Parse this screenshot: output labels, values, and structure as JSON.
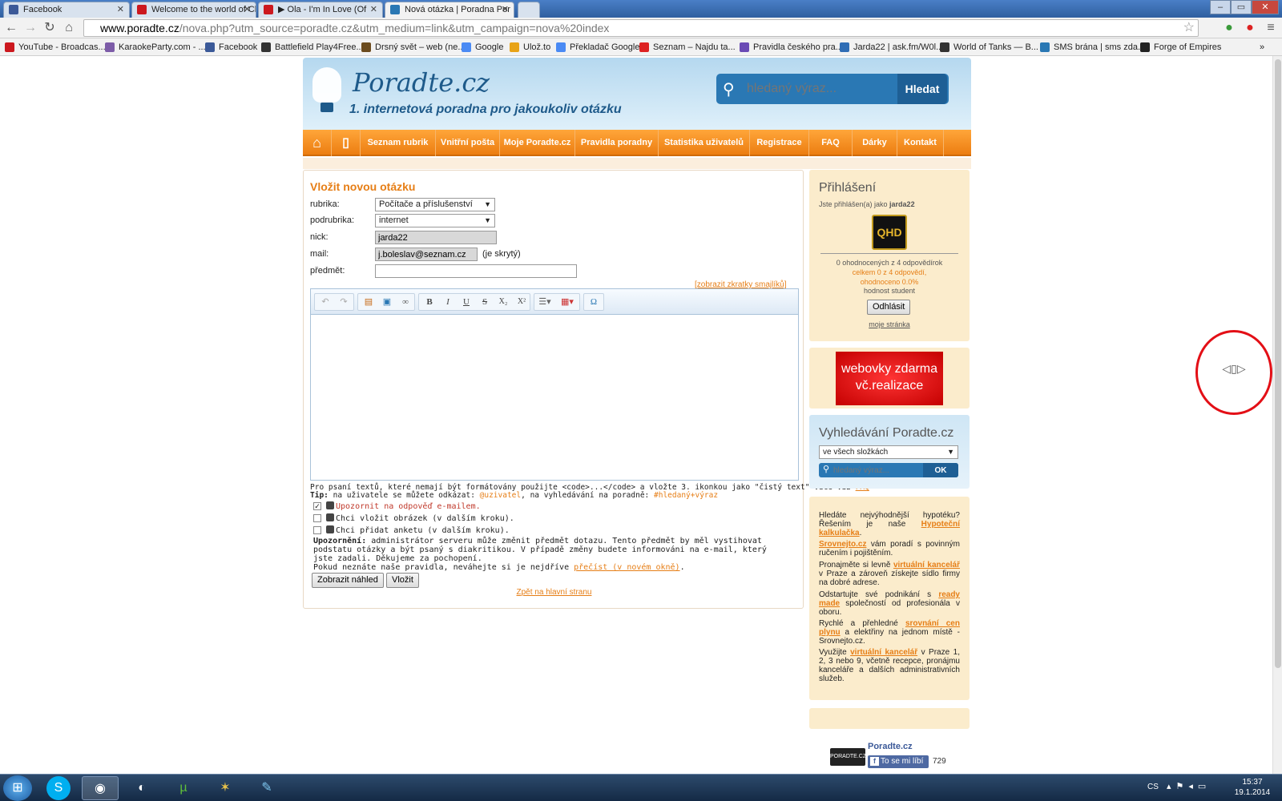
{
  "browser": {
    "tabs": [
      {
        "label": "Facebook",
        "color": "#3b5998"
      },
      {
        "label": "Welcome to the world of Ch",
        "color": "#cc181e"
      },
      {
        "label": "▶ Ola - I'm In Love (Of",
        "color": "#cc181e"
      },
      {
        "label": "Nová otázka | Poradna Por",
        "color": "#2a78b4"
      }
    ],
    "url_host": "www.poradte.cz",
    "url_rest": "/nova.php?utm_source=poradte.cz&utm_medium=link&utm_campaign=nova%20index",
    "bookmarks": [
      "YouTube - Broadcas...",
      "KaraokeParty.com - ...",
      "Facebook",
      "Battlefield Play4Free...",
      "Drsný svět – web (ne...",
      "Google",
      "Ulož.to",
      "Překladač Google",
      "Seznam – Najdu ta...",
      "Pravidla českého pra...",
      "Jarda22 | ask.fm/W0l...",
      "World of Tanks — B...",
      "SMS brána | sms zda...",
      "Forge of Empires"
    ],
    "bookmarks_more": "»"
  },
  "header": {
    "logo": "Poradte.cz",
    "tagline": "1. internetová poradna pro jakoukoliv otázku",
    "search_placeholder": "hledaný výraz...",
    "search_button": "Hledat"
  },
  "menu": {
    "items": [
      "Seznam rubrik",
      "Vnitřní pošta",
      "Moje Poradte.cz",
      "Pravidla poradny",
      "Statistika uživatelů",
      "Registrace",
      "FAQ",
      "Dárky",
      "Kontakt"
    ]
  },
  "form": {
    "title": "Vložit novou otázku",
    "rubrika_label": "rubrika:",
    "rubrika_value": "Počítače a příslušenství",
    "podrubrika_label": "podrubrika:",
    "podrubrika_value": "internet",
    "nick_label": "nick:",
    "nick_value": "jarda22",
    "mail_label": "mail:",
    "mail_value": "j.boleslav@seznam.cz",
    "mail_hidden_note": "(je skrytý)",
    "predmet_label": "předmět:",
    "predmet_value": "",
    "smileys_link": "[zobrazit zkratky smajlíků]",
    "help_text_1a": "Pro psaní textů, které nemají být formátovány použijte <code>...</code> a vložte 3. ikonkou jako \"čistý text\" více viz ",
    "help_text_1_link": "FAQ",
    "help_tip_bold": "Tip:",
    "help_text_2a": " na uživatele se můžete odkázat: ",
    "help_text_2_user": "@uzivatel",
    "help_text_2b": ", na vyhledávání na poradně: ",
    "help_text_2_tag": "#hledaný+výraz",
    "check_email": "Upozornit na odpověď e-mailem.",
    "check_image": "Chci vložit obrázek (v dalším kroku).",
    "check_poll": "Chci přidat anketu (v dalším kroku).",
    "notice_bold": "Upozornění:",
    "notice_text": " administrátor serveru může změnit předmět dotazu. Tento předmět by měl vystihovat podstatu otázky a být psaný s diakritikou. V případě změny budete informováni na e-mail, který jste zadali. Děkujeme za pochopení.",
    "notice_text_2": "Pokud neznáte naše pravidla, neváhejte si je nejdříve ",
    "notice_link": "přečíst (v novém okně)",
    "preview_button": "Zobrazit náhled",
    "submit_button": "Vložit",
    "back_link": "Zpět na hlavní stranu"
  },
  "editor": {
    "buttons": [
      "undo-icon",
      "redo-icon",
      "paste-text-icon",
      "image-icon",
      "link-icon",
      "bold-icon",
      "italic-icon",
      "underline-icon",
      "strike-icon",
      "subscript-icon",
      "superscript-icon",
      "list-icon",
      "table-icon",
      "omega-icon"
    ],
    "bold": "B",
    "italic": "I",
    "underline": "U",
    "strike": "S",
    "sub": "X₂",
    "sup": "X²",
    "omega": "Ω"
  },
  "login": {
    "title": "Přihlášení",
    "logged_as": "Jste přihlášen(a) jako ",
    "username": "jarda22",
    "avatar_text": "QHD",
    "stat_1": "0 ohodnocených z 4 odpovědírok",
    "stat_2": "celkem 0 z 4 odpovědí,",
    "stat_3": "ohodnoceno 0.0%",
    "stat_4": "hodnost student",
    "logout_button": "Odhlásit",
    "my_page": "moje stránka"
  },
  "ad": {
    "line1": "webovky zdarma",
    "line2": "vč.realizace"
  },
  "side_search": {
    "title": "Vyhledávání Poradte.cz",
    "scope": "ve všech složkách",
    "placeholder": "hledaný výraz...",
    "button": "OK"
  },
  "promo": [
    {
      "pre": "Hledáte nejvýhodnější hypotéku? Řešením je naše ",
      "link": "Hypoteční kalkulačka",
      "post": "."
    },
    {
      "pre": "",
      "link": "Srovnejto.cz",
      "post": " vám poradí s povinným ručením i pojištěním."
    },
    {
      "pre": "Pronajměte si levně ",
      "link": "virtuální kancelář",
      "post": " v Praze a zároveň získejte sídlo firmy na dobré adrese."
    },
    {
      "pre": "Odstartujte své podnikání s ",
      "link": "ready made",
      "post": " společností od profesionála v oboru."
    },
    {
      "pre": "Rychlé a přehledné ",
      "link": "srovnání cen plynu",
      "post": " a elektřiny na jednom místě - Srovnejto.cz."
    },
    {
      "pre": "Využijte ",
      "link": "virtuální kancelář",
      "post": " v Praze 1, 2, 3 nebo 9, včetně recepce, pronájmu kanceláře a dalších administrativních služeb."
    }
  ],
  "facebook": {
    "logo": "PORADTE.CZ",
    "name": "Poradte.cz",
    "like": "To se mi líbí",
    "count": "729"
  },
  "taskbar": {
    "lang": "CS",
    "time": "15:37",
    "date": "19.1.2014"
  }
}
